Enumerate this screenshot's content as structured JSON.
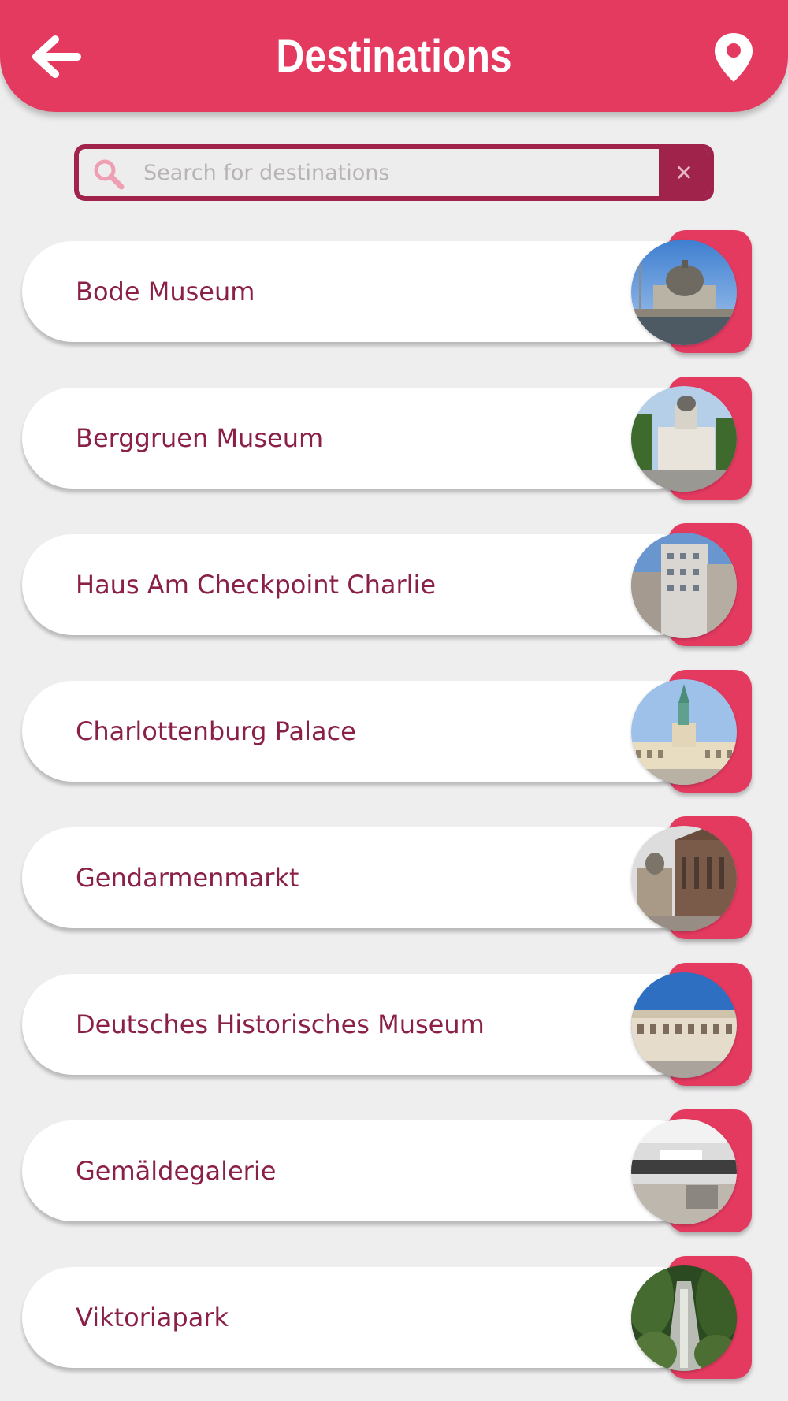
{
  "header": {
    "title": "Destinations",
    "back_icon": "arrow-left-icon",
    "location_icon": "map-pin-icon"
  },
  "search": {
    "placeholder": "Search for destinations",
    "value": "",
    "search_icon": "magnifier-icon",
    "clear_icon": "close-icon"
  },
  "colors": {
    "primary": "#e53a60",
    "dark_accent": "#a0234b",
    "text": "#8a2048",
    "background": "#efeeef"
  },
  "destinations": [
    {
      "name": "Bode Museum"
    },
    {
      "name": "Berggruen Museum"
    },
    {
      "name": "Haus Am Checkpoint Charlie"
    },
    {
      "name": "Charlottenburg Palace"
    },
    {
      "name": "Gendarmenmarkt"
    },
    {
      "name": "Deutsches Historisches Museum"
    },
    {
      "name": "Gemäldegalerie"
    },
    {
      "name": "Viktoriapark"
    }
  ]
}
